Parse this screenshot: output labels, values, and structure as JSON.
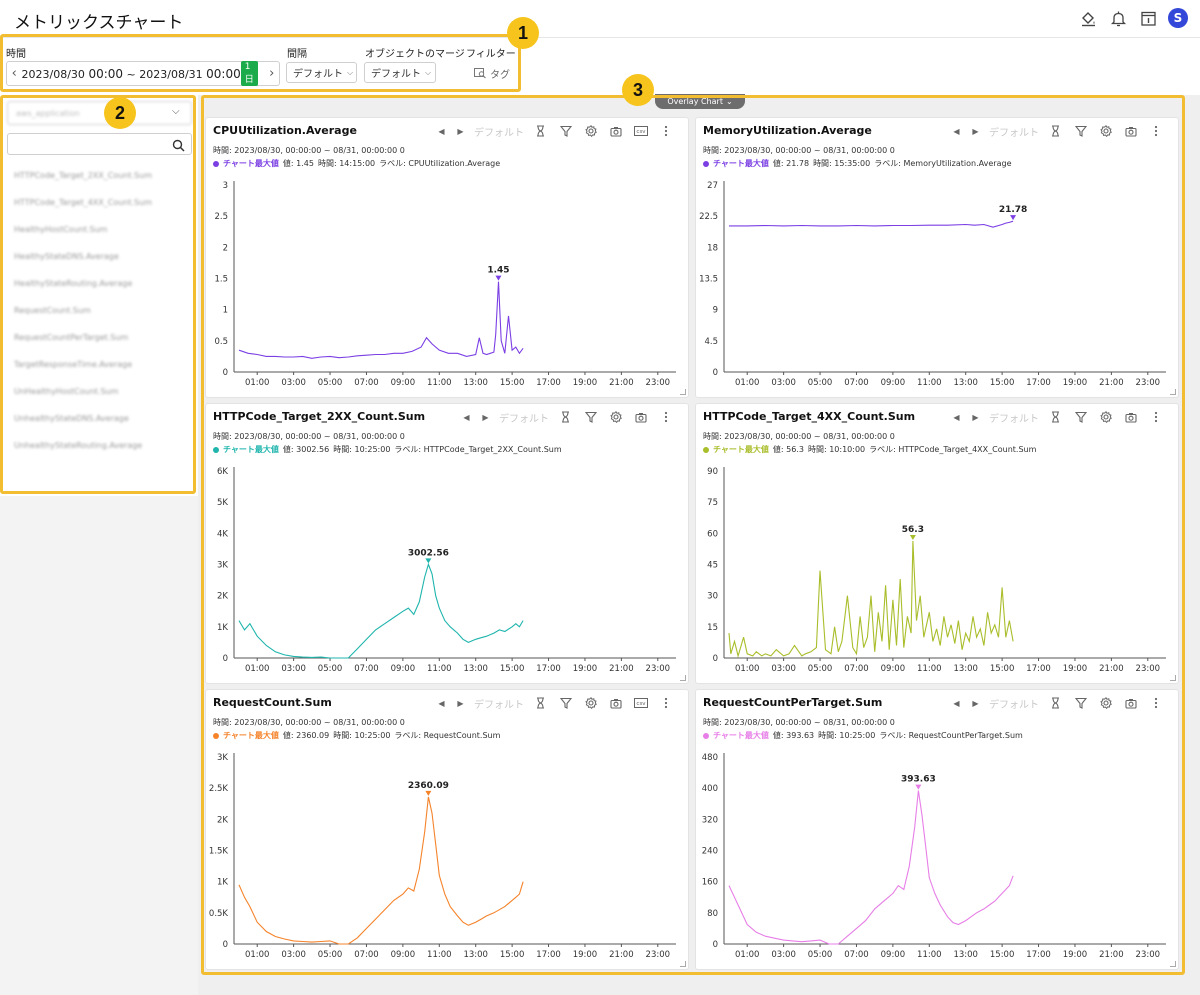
{
  "app": {
    "title": "メトリックスチャート"
  },
  "filters": {
    "time_label": "時間",
    "date_range_start": "2023/08/30",
    "date_range_start_time": "00:00",
    "date_range_sep": "~",
    "date_range_end": "2023/08/31",
    "date_range_end_time": "00:00",
    "duration_badge": "1日",
    "interval_label": "間隔",
    "interval_value": "デフォルト",
    "merge_label": "オブジェクトのマージ",
    "merge_value": "デフォルト",
    "filter_label": "フィルター",
    "tag_button": "タグ"
  },
  "badges": [
    "1",
    "2",
    "3"
  ],
  "sidebar": {
    "select_value": "aws_application",
    "search_placeholder": "",
    "items": [
      "HTTPCode_Target_2XX_Count.Sum",
      "HTTPCode_Target_4XX_Count.Sum",
      "HealthyHostCount.Sum",
      "HealthyStateDNS.Average",
      "HealthyStateRouting.Average",
      "RequestCount.Sum",
      "RequestCountPerTarget.Sum",
      "TargetResponseTime.Average",
      "UnHealthyHostCount.Sum",
      "UnhealthyStateDNS.Average",
      "UnhealthyStateRouting.Average"
    ]
  },
  "overlay": {
    "label": "Overlay Chart"
  },
  "toolbar": {
    "default_label": "デフォルト",
    "csv_label": "csv"
  },
  "colors": {
    "callout": "#f2bd30",
    "badge": "#f6c41c",
    "cpu": "#7b3fe4",
    "memory": "#7b3fe4",
    "http2xx": "#1fb5ad",
    "http4xx": "#aabd2a",
    "request": "#f5832a",
    "request_per_target": "#e77ee7"
  },
  "charts": [
    {
      "title": "CPUUtilization.Average",
      "info": "時間: 2023/08/30, 00:00:00 ~ 08/31, 00:00:00   0",
      "legend_name": "チャート最大値",
      "legend_value": "値: 1.45",
      "legend_time": "時間: 14:15:00",
      "legend_label": "ラベル: CPUUtilization.Average",
      "color": "#7b3fe4",
      "has_csv": true
    },
    {
      "title": "MemoryUtilization.Average",
      "info": "時間: 2023/08/30, 00:00:00 ~ 08/31, 00:00:00   0",
      "legend_name": "チャート最大値",
      "legend_value": "値: 21.78",
      "legend_time": "時間: 15:35:00",
      "legend_label": "ラベル: MemoryUtilization.Average",
      "color": "#7b3fe4",
      "has_csv": false
    },
    {
      "title": "HTTPCode_Target_2XX_Count.Sum",
      "info": "時間: 2023/08/30, 00:00:00 ~ 08/31, 00:00:00   0",
      "legend_name": "チャート最大値",
      "legend_value": "値: 3002.56",
      "legend_time": "時間: 10:25:00",
      "legend_label": "ラベル: HTTPCode_Target_2XX_Count.Sum",
      "color": "#1fb5ad",
      "has_csv": false
    },
    {
      "title": "HTTPCode_Target_4XX_Count.Sum",
      "info": "時間: 2023/08/30, 00:00:00 ~ 08/31, 00:00:00   0",
      "legend_name": "チャート最大値",
      "legend_value": "値: 56.3",
      "legend_time": "時間: 10:10:00",
      "legend_label": "ラベル: HTTPCode_Target_4XX_Count.Sum",
      "color": "#aabd2a",
      "has_csv": false
    },
    {
      "title": "RequestCount.Sum",
      "info": "時間: 2023/08/30, 00:00:00 ~ 08/31, 00:00:00   0",
      "legend_name": "チャート最大値",
      "legend_value": "値: 2360.09",
      "legend_time": "時間: 10:25:00",
      "legend_label": "ラベル: RequestCount.Sum",
      "color": "#f5832a",
      "has_csv": true
    },
    {
      "title": "RequestCountPerTarget.Sum",
      "info": "時間: 2023/08/30, 00:00:00 ~ 08/31, 00:00:00   0",
      "legend_name": "チャート最大値",
      "legend_value": "値: 393.63",
      "legend_time": "時間: 10:25:00",
      "legend_label": "ラベル: RequestCountPerTarget.Sum",
      "color": "#e77ee7",
      "has_csv": false
    }
  ],
  "chart_data": [
    {
      "type": "line",
      "title": "CPUUtilization.Average",
      "x_ticks": [
        "01:00",
        "03:00",
        "05:00",
        "07:00",
        "09:00",
        "11:00",
        "13:00",
        "15:00",
        "17:00",
        "19:00",
        "21:00",
        "23:00"
      ],
      "y_ticks": [
        "0",
        "0.5",
        "1",
        "1.5",
        "2",
        "2.5",
        "3"
      ],
      "ylim": [
        0,
        3
      ],
      "x_hours": [
        0,
        0.5,
        1,
        1.5,
        2,
        2.5,
        3,
        3.5,
        4,
        4.5,
        5,
        5.5,
        6,
        6.5,
        7,
        7.5,
        8,
        8.5,
        9,
        9.5,
        10,
        10.3,
        10.6,
        11,
        11.5,
        12,
        12.5,
        13,
        13.2,
        13.4,
        13.6,
        13.8,
        14,
        14.1,
        14.25,
        14.4,
        14.6,
        14.8,
        15,
        15.2,
        15.4,
        15.6
      ],
      "values": [
        0.35,
        0.3,
        0.28,
        0.25,
        0.25,
        0.24,
        0.24,
        0.25,
        0.22,
        0.24,
        0.25,
        0.23,
        0.24,
        0.26,
        0.27,
        0.28,
        0.28,
        0.3,
        0.3,
        0.33,
        0.4,
        0.55,
        0.45,
        0.35,
        0.3,
        0.3,
        0.25,
        0.28,
        0.55,
        0.3,
        0.28,
        0.3,
        0.32,
        0.6,
        1.45,
        0.5,
        0.3,
        0.9,
        0.35,
        0.4,
        0.3,
        0.38
      ],
      "peak_label": "1.45",
      "peak_x": 14.25,
      "peak_y": 1.45
    },
    {
      "type": "line",
      "title": "MemoryUtilization.Average",
      "x_ticks": [
        "01:00",
        "03:00",
        "05:00",
        "07:00",
        "09:00",
        "11:00",
        "13:00",
        "15:00",
        "17:00",
        "19:00",
        "21:00",
        "23:00"
      ],
      "y_ticks": [
        "0",
        "4.5",
        "9",
        "13.5",
        "18",
        "22.5",
        "27"
      ],
      "ylim": [
        0,
        27
      ],
      "x_hours": [
        0,
        1,
        2,
        3,
        4,
        5,
        6,
        7,
        8,
        9,
        10,
        11,
        12,
        13,
        13.5,
        14,
        14.5,
        15,
        15.2,
        15.4,
        15.6
      ],
      "values": [
        21.1,
        21.1,
        21.15,
        21.1,
        21.15,
        21.1,
        21.1,
        21.15,
        21.1,
        21.15,
        21.15,
        21.2,
        21.2,
        21.3,
        21.2,
        21.3,
        20.9,
        21.3,
        21.5,
        21.6,
        21.78
      ],
      "peak_label": "21.78",
      "peak_x": 15.6,
      "peak_y": 21.78
    },
    {
      "type": "line",
      "title": "HTTPCode_Target_2XX_Count.Sum",
      "x_ticks": [
        "01:00",
        "03:00",
        "05:00",
        "07:00",
        "09:00",
        "11:00",
        "13:00",
        "15:00",
        "17:00",
        "19:00",
        "21:00",
        "23:00"
      ],
      "y_ticks": [
        "0",
        "1K",
        "2K",
        "3K",
        "4K",
        "5K",
        "6K"
      ],
      "ylim": [
        0,
        6000
      ],
      "x_hours": [
        0,
        0.3,
        0.6,
        1,
        1.5,
        2,
        2.5,
        3,
        3.5,
        4,
        4.5,
        5,
        5.5,
        6,
        6.5,
        7,
        7.5,
        8,
        8.5,
        9,
        9.3,
        9.6,
        9.9,
        10.2,
        10.4,
        10.6,
        10.8,
        11,
        11.3,
        11.6,
        12,
        12.3,
        12.6,
        13,
        13.3,
        13.6,
        14,
        14.3,
        14.6,
        15,
        15.2,
        15.4,
        15.6
      ],
      "values": [
        1200,
        900,
        1100,
        700,
        400,
        200,
        100,
        50,
        30,
        20,
        30,
        0,
        0,
        0,
        300,
        600,
        900,
        1100,
        1300,
        1500,
        1600,
        1400,
        1800,
        2600,
        3002.56,
        2700,
        2000,
        1600,
        1200,
        1000,
        800,
        600,
        500,
        600,
        650,
        700,
        800,
        900,
        850,
        1000,
        1100,
        1000,
        1200
      ],
      "peak_label": "3002.56",
      "peak_x": 10.4,
      "peak_y": 3002.56
    },
    {
      "type": "line",
      "title": "HTTPCode_Target_4XX_Count.Sum",
      "x_ticks": [
        "01:00",
        "03:00",
        "05:00",
        "07:00",
        "09:00",
        "11:00",
        "13:00",
        "15:00",
        "17:00",
        "19:00",
        "21:00",
        "23:00"
      ],
      "y_ticks": [
        "0",
        "15",
        "30",
        "45",
        "60",
        "75",
        "90"
      ],
      "ylim": [
        0,
        90
      ],
      "x_hours": [
        0,
        0.1,
        0.3,
        0.5,
        0.8,
        1,
        1.3,
        1.5,
        1.8,
        2,
        2.3,
        2.6,
        3,
        3.3,
        3.6,
        4,
        4.2,
        4.5,
        4.8,
        5,
        5.3,
        5.6,
        5.8,
        6,
        6.2,
        6.5,
        6.8,
        7,
        7.2,
        7.4,
        7.6,
        7.8,
        8,
        8.2,
        8.4,
        8.6,
        8.8,
        9,
        9.2,
        9.4,
        9.6,
        9.8,
        10,
        10.1,
        10.3,
        10.5,
        10.7,
        11,
        11.2,
        11.4,
        11.6,
        11.8,
        12,
        12.2,
        12.4,
        12.6,
        12.8,
        13,
        13.2,
        13.4,
        13.6,
        13.8,
        14,
        14.2,
        14.4,
        14.6,
        14.8,
        15,
        15.2,
        15.4,
        15.6
      ],
      "values": [
        12,
        2,
        8,
        1,
        10,
        2,
        1,
        3,
        1,
        2,
        1,
        4,
        1,
        2,
        6,
        1,
        2,
        3,
        5,
        42,
        4,
        2,
        15,
        3,
        8,
        30,
        5,
        2,
        20,
        5,
        10,
        30,
        3,
        22,
        8,
        35,
        4,
        28,
        6,
        38,
        5,
        20,
        12,
        56.3,
        18,
        30,
        10,
        22,
        8,
        14,
        6,
        20,
        10,
        16,
        7,
        18,
        4,
        12,
        8,
        20,
        10,
        14,
        6,
        22,
        12,
        16,
        10,
        34,
        10,
        18,
        8
      ],
      "peak_label": "56.3",
      "peak_x": 10.1,
      "peak_y": 56.3
    },
    {
      "type": "line",
      "title": "RequestCount.Sum",
      "x_ticks": [
        "01:00",
        "03:00",
        "05:00",
        "07:00",
        "09:00",
        "11:00",
        "13:00",
        "15:00",
        "17:00",
        "19:00",
        "21:00",
        "23:00"
      ],
      "y_ticks": [
        "0",
        "0.5K",
        "1K",
        "1.5K",
        "2K",
        "2.5K",
        "3K"
      ],
      "ylim": [
        0,
        3000
      ],
      "x_hours": [
        0,
        0.3,
        0.6,
        1,
        1.5,
        2,
        2.5,
        3,
        3.5,
        4,
        4.5,
        5,
        5.5,
        6,
        6.5,
        7,
        7.5,
        8,
        8.5,
        9,
        9.3,
        9.6,
        9.9,
        10.2,
        10.4,
        10.6,
        10.8,
        11,
        11.3,
        11.6,
        12,
        12.3,
        12.6,
        13,
        13.3,
        13.6,
        14,
        14.3,
        14.6,
        15,
        15.2,
        15.4,
        15.6
      ],
      "values": [
        950,
        750,
        600,
        350,
        200,
        120,
        80,
        50,
        40,
        30,
        40,
        50,
        0,
        0,
        100,
        250,
        400,
        550,
        700,
        800,
        900,
        850,
        1200,
        1800,
        2360.09,
        2100,
        1600,
        1100,
        800,
        600,
        450,
        350,
        300,
        350,
        400,
        450,
        500,
        550,
        600,
        700,
        750,
        800,
        1000
      ],
      "peak_label": "2360.09",
      "peak_x": 10.4,
      "peak_y": 2360.09
    },
    {
      "type": "line",
      "title": "RequestCountPerTarget.Sum",
      "x_ticks": [
        "01:00",
        "03:00",
        "05:00",
        "07:00",
        "09:00",
        "11:00",
        "13:00",
        "15:00",
        "17:00",
        "19:00",
        "21:00",
        "23:00"
      ],
      "y_ticks": [
        "0",
        "80",
        "160",
        "240",
        "320",
        "400",
        "480"
      ],
      "ylim": [
        0,
        480
      ],
      "x_hours": [
        0,
        0.3,
        0.6,
        1,
        1.5,
        2,
        2.5,
        3,
        3.5,
        4,
        4.5,
        5,
        5.5,
        6,
        6.5,
        7,
        7.5,
        8,
        8.5,
        9,
        9.3,
        9.6,
        9.9,
        10.2,
        10.4,
        10.6,
        10.8,
        11,
        11.3,
        11.6,
        12,
        12.3,
        12.6,
        13,
        13.3,
        13.6,
        14,
        14.3,
        14.6,
        15,
        15.2,
        15.4,
        15.6
      ],
      "values": [
        150,
        120,
        90,
        50,
        30,
        20,
        15,
        10,
        8,
        6,
        8,
        10,
        0,
        0,
        20,
        40,
        60,
        90,
        110,
        130,
        150,
        140,
        200,
        300,
        393.63,
        330,
        250,
        170,
        130,
        100,
        70,
        55,
        50,
        60,
        70,
        80,
        90,
        100,
        110,
        130,
        140,
        150,
        175
      ],
      "peak_label": "393.63",
      "peak_x": 10.4,
      "peak_y": 393.63
    }
  ]
}
